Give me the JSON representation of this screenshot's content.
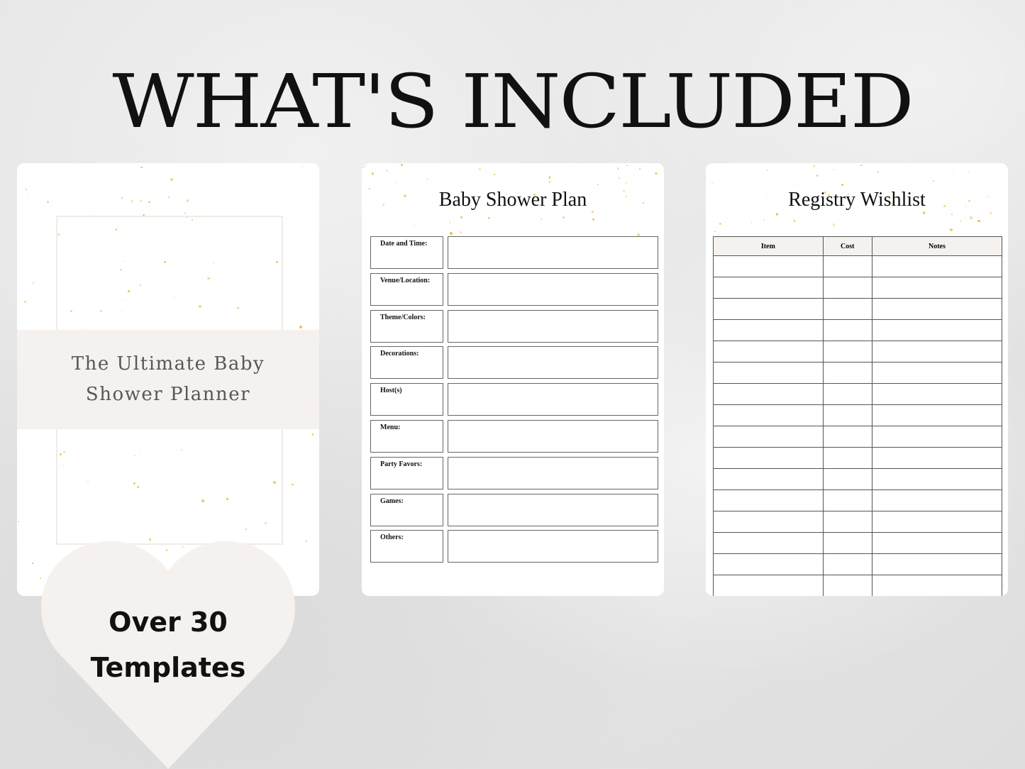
{
  "header": {
    "title": "WHAT'S INCLUDED"
  },
  "cover": {
    "title_line1": "The Ultimate Baby",
    "title_line2": "Shower Planner"
  },
  "plan": {
    "title": "Baby Shower Plan",
    "rows": [
      "Date and Time:",
      "Venue/Location:",
      "Theme/Colors:",
      "Decorations:",
      "Host(s)",
      "Menu:",
      "Party Favors:",
      "Games:",
      "Others:"
    ]
  },
  "wishlist": {
    "title": "Registry Wishlist",
    "columns": [
      "Item",
      "Cost",
      "Notes"
    ],
    "empty_rows": 16
  },
  "badge": {
    "line1": "Over 30",
    "line2": "Templates"
  },
  "colors": {
    "accent_gold": "#e8c04a",
    "band": "#f5f1ef",
    "heart": "#f5f1ef"
  }
}
